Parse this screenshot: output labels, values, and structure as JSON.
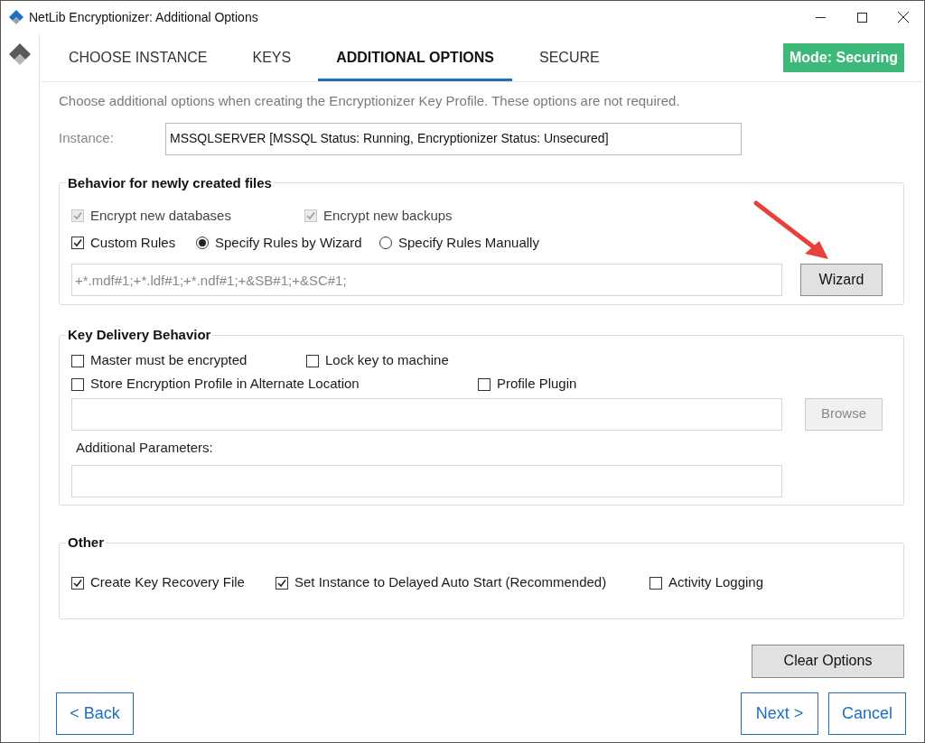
{
  "window": {
    "title": "NetLib Encryptionizer: Additional Options"
  },
  "tabs": [
    {
      "label": "CHOOSE INSTANCE",
      "selected": false
    },
    {
      "label": "KEYS",
      "selected": false
    },
    {
      "label": "ADDITIONAL OPTIONS",
      "selected": true
    },
    {
      "label": "SECURE",
      "selected": false
    }
  ],
  "mode_badge": "Mode: Securing",
  "description": "Choose additional options when creating the Encryptionizer Key Profile. These options are not required.",
  "instance": {
    "label": "Instance:",
    "value": "MSSQLSERVER [MSSQL Status: Running, Encryptionizer Status: Unsecured]"
  },
  "behavior": {
    "title": "Behavior for newly created files",
    "rows": [
      [
        {
          "kind": "checkbox",
          "label": "Encrypt new databases",
          "checked": true,
          "disabled": true
        },
        {
          "kind": "checkbox",
          "label": "Encrypt new backups",
          "checked": true,
          "disabled": true
        }
      ],
      [
        {
          "kind": "checkbox",
          "label": "Custom Rules",
          "checked": true,
          "disabled": false
        },
        {
          "kind": "radio",
          "label": "Specify Rules by Wizard",
          "selected": true
        },
        {
          "kind": "radio",
          "label": "Specify Rules Manually",
          "selected": false
        }
      ]
    ],
    "rules_field": {
      "value": "+*.mdf#1;+*.ldf#1;+*.ndf#1;+&SB#1;+&SC#1;"
    },
    "wizard_button": {
      "label": "Wizard",
      "disabled": false
    }
  },
  "key_delivery": {
    "title": "Key Delivery Behavior",
    "rows": [
      [
        {
          "kind": "checkbox",
          "label": "Master must be encrypted",
          "checked": false,
          "disabled": false
        },
        {
          "kind": "checkbox",
          "label": "Lock key to machine",
          "checked": false,
          "disabled": false
        }
      ],
      [
        {
          "kind": "checkbox",
          "label": "Store Encryption Profile in Alternate Location",
          "checked": false,
          "disabled": false
        },
        {
          "kind": "checkbox",
          "label": "Profile Plugin",
          "checked": false,
          "disabled": false
        }
      ]
    ],
    "browse_button": {
      "label": "Browse",
      "disabled": true
    },
    "params_label": "Additional Parameters:"
  },
  "other": {
    "title": "Other",
    "rows": [
      [
        {
          "kind": "checkbox",
          "label": "Create Key Recovery File",
          "checked": true,
          "disabled": false
        },
        {
          "kind": "checkbox",
          "label": "Set Instance to Delayed Auto Start (Recommended)",
          "checked": true,
          "disabled": false
        },
        {
          "kind": "checkbox",
          "label": "Activity Logging",
          "checked": false,
          "disabled": false
        }
      ]
    ]
  },
  "buttons": {
    "clear": "Clear Options",
    "back": "< Back",
    "next": "Next >",
    "cancel": "Cancel"
  }
}
